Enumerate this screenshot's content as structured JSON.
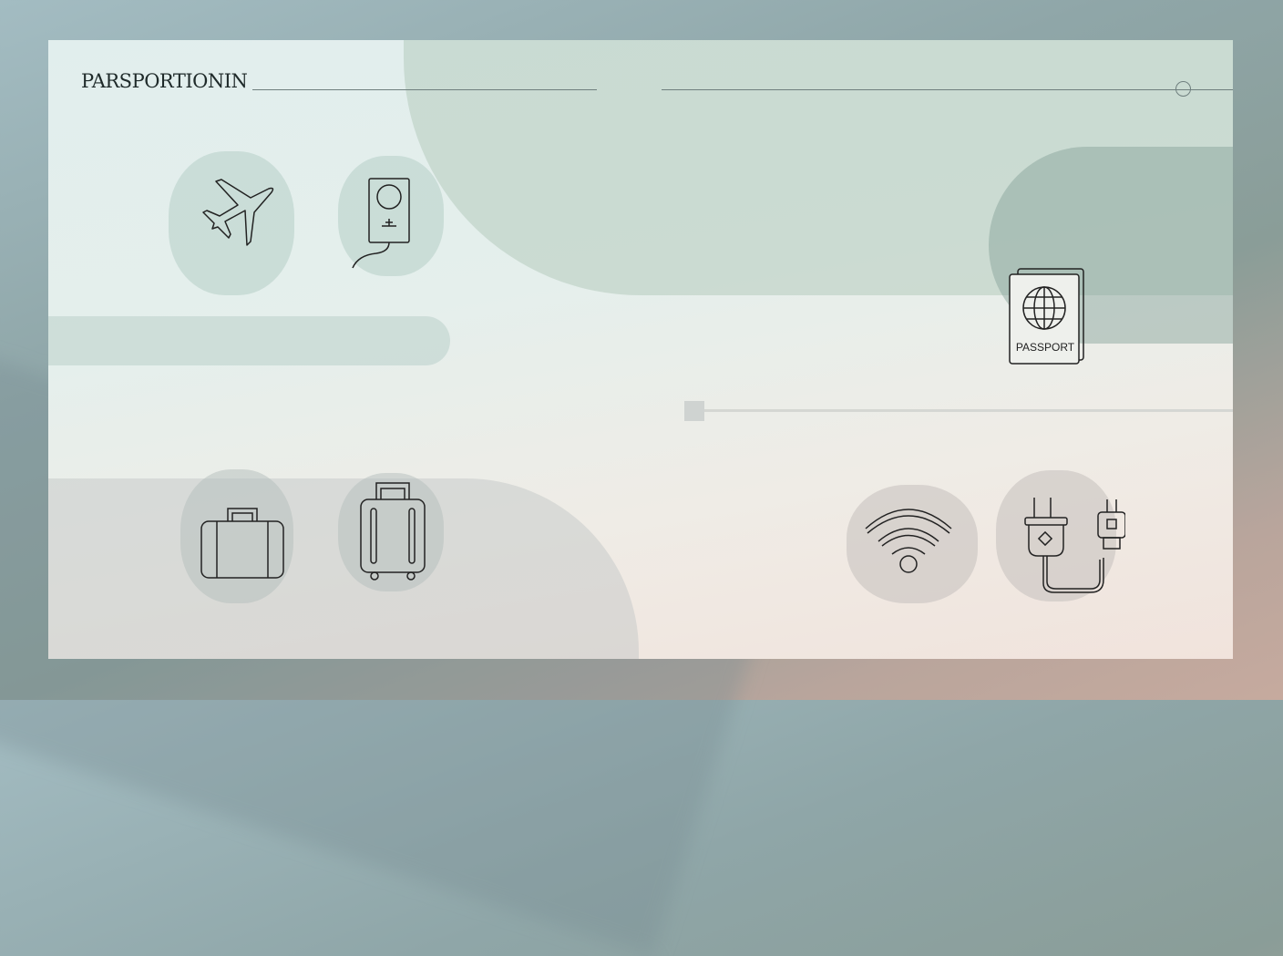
{
  "header": {
    "title": "PARSPORTIONIN"
  },
  "icons": [
    "airplane-icon",
    "passport-book-icon",
    "passport-icon",
    "briefcase-icon",
    "suitcase-icon",
    "wifi-icon",
    "plug-icon"
  ],
  "passport": {
    "label": "PASSPORT"
  }
}
